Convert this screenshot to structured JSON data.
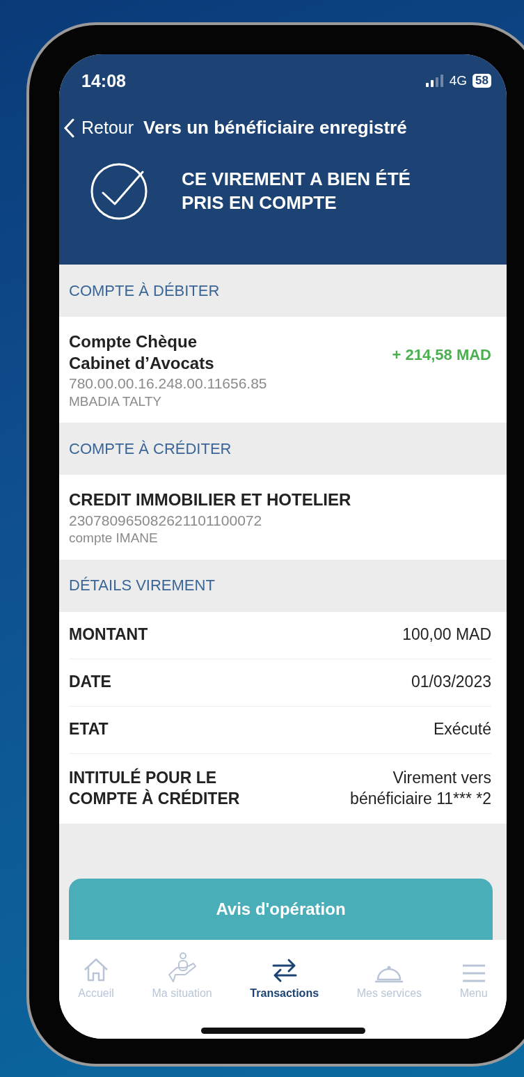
{
  "status_bar": {
    "time": "14:08",
    "network": "4G",
    "battery": "58"
  },
  "nav": {
    "back": "Retour",
    "title": "Vers un bénéficiaire enregistré"
  },
  "confirmation": {
    "message": "CE VIREMENT A BIEN ÉTÉ PRIS EN COMPTE"
  },
  "debit_section": {
    "heading": "COMPTE À DÉBITER",
    "account_name": [
      "Compte Chèque",
      "Cabinet d’Avocats"
    ],
    "balance": "+ 214,58 MAD",
    "account_number": "780.00.00.16.248.00.11656.85",
    "holder": "MBADIA TALTY"
  },
  "credit_section": {
    "heading": "COMPTE À CRÉDITER",
    "bank": "CREDIT IMMOBILIER ET HOTELIER",
    "account_number": "230780965082621101100072",
    "holder": "compte IMANE"
  },
  "details_section": {
    "heading": "DÉTAILS VIREMENT",
    "rows": [
      {
        "label": "MONTANT",
        "value": "100,00 MAD"
      },
      {
        "label": "DATE",
        "value": "01/03/2023"
      },
      {
        "label": "ETAT",
        "value": "Exécuté"
      },
      {
        "label": "INTITULÉ POUR LE COMPTE À CRÉDITER",
        "value": "Virement vers bénéficiaire 11*** *2"
      }
    ]
  },
  "action_button": "Avis d'opération",
  "tab_bar": [
    {
      "label": "Accueil",
      "selected": false
    },
    {
      "label": "Ma situation",
      "selected": false
    },
    {
      "label": "Transactions",
      "selected": true
    },
    {
      "label": "Mes services",
      "selected": false
    },
    {
      "label": "Menu",
      "selected": false
    }
  ]
}
